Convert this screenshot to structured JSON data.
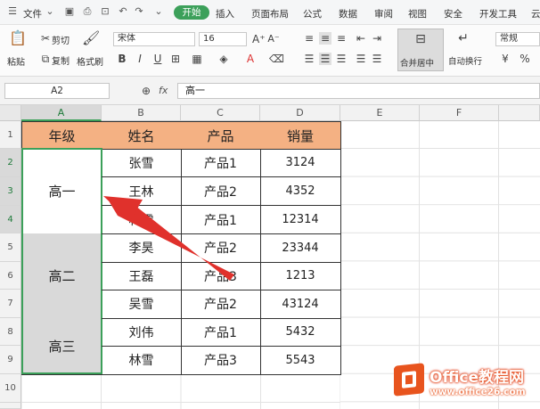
{
  "menu": {
    "file_label": "文件",
    "tabs": [
      "开始",
      "插入",
      "页面布局",
      "公式",
      "数据",
      "审阅",
      "视图",
      "安全",
      "开发工具",
      "云"
    ]
  },
  "ribbon": {
    "paste": "粘贴",
    "cut": "剪切",
    "copy": "复制",
    "format_painter": "格式刷",
    "font_name": "宋体",
    "font_size": "16",
    "bold": "B",
    "italic": "I",
    "underline": "U",
    "merge_center": "合并居中",
    "wrap_text": "自动换行",
    "number_format": "常规",
    "font_color_a": "A"
  },
  "formula_bar": {
    "cell_ref": "A2",
    "fx": "fx",
    "content": "高一"
  },
  "sheet": {
    "columns": [
      "A",
      "B",
      "C",
      "D",
      "E",
      "F"
    ],
    "rows": [
      "1",
      "2",
      "3",
      "4",
      "5",
      "6",
      "7",
      "8",
      "9",
      "10"
    ],
    "header": [
      "年级",
      "姓名",
      "产品",
      "销量"
    ],
    "groups": [
      "高一",
      "高二",
      "高三"
    ],
    "names": [
      "张雪",
      "王林",
      "林雪",
      "李昊",
      "王磊",
      "吴雪",
      "刘伟",
      "林雪"
    ],
    "products": [
      "产品1",
      "产品2",
      "产品1",
      "产品2",
      "产品3",
      "产品2",
      "产品1",
      "产品3"
    ],
    "sales": [
      "3124",
      "4352",
      "12314",
      "23344",
      "1213",
      "43124",
      "5432",
      "5543"
    ]
  },
  "watermark": {
    "brand": "Office教程网",
    "url": "www.office26.com"
  },
  "colors": {
    "header_fill": "#f4b183",
    "merged_fill": "#d9d9d9",
    "accent": "#3ca05a",
    "arrow": "#e0312c"
  }
}
